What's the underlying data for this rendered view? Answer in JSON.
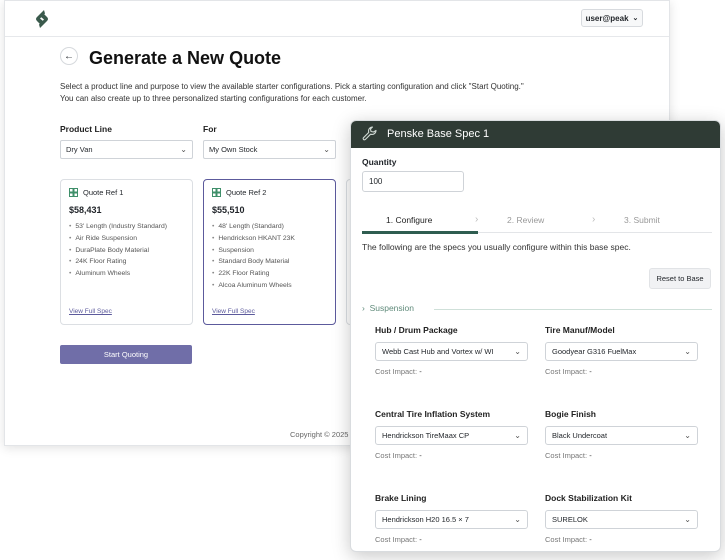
{
  "header": {
    "user": "user@peak"
  },
  "page": {
    "title": "Generate a New Quote",
    "description_line1": "Select a product line and purpose to view the available starter configurations. Pick a starting configuration and click \"Start Quoting.\"",
    "description_line2": "You can also create up to three personalized starting configurations for each customer.",
    "product_line_label": "Product Line",
    "product_line_value": "Dry Van",
    "for_label": "For",
    "for_value": "My Own Stock",
    "start_button": "Start Quoting",
    "copyright": "Copyright © 2025"
  },
  "cards": [
    {
      "name": "Quote Ref 1",
      "price": "$58,431",
      "features": [
        "53' Length (Industry Standard)",
        "Air Ride Suspension",
        "DuraPlate Body Material",
        "24K Floor Rating",
        "Aluminum Wheels"
      ],
      "link": "View Full Spec"
    },
    {
      "name": "Quote Ref 2",
      "price": "$55,510",
      "features": [
        "48' Length (Standard)",
        "Hendrickson HKANT 23K",
        "Suspension",
        "Standard Body Material",
        "22K Floor Rating",
        "Alcoa Aluminum Wheels"
      ],
      "link": "View Full Spec"
    }
  ],
  "panel": {
    "title": "Penske Base Spec 1",
    "quantity_label": "Quantity",
    "quantity_value": "100",
    "steps": [
      "1. Configure",
      "2. Review",
      "3. Submit"
    ],
    "description": "The following are the specs you usually configure within this base spec.",
    "reset_button": "Reset to Base",
    "section": "Suspension",
    "cost_label": "Cost Impact:",
    "cost_value": "-",
    "specs": [
      {
        "label": "Hub / Drum Package",
        "value": "Webb Cast Hub and Vortex w/ WI"
      },
      {
        "label": "Tire Manuf/Model",
        "value": "Goodyear G316 FuelMax"
      },
      {
        "label": "Central Tire Inflation System",
        "value": "Hendrickson TireMaax CP"
      },
      {
        "label": "Bogie Finish",
        "value": "Black Undercoat"
      },
      {
        "label": "Brake Lining",
        "value": "Hendrickson H20 16.5 × 7"
      },
      {
        "label": "Dock Stabilization Kit",
        "value": "SURELOK"
      }
    ]
  },
  "colors": {
    "accent": "#706ea8",
    "panel_header": "#2f3b35",
    "step_active": "#2f5d50"
  },
  "icons": [
    "logo-icon",
    "chevron-down-icon",
    "back-arrow-icon",
    "grid-icon",
    "wrench-icon",
    "chevron-right-icon"
  ]
}
